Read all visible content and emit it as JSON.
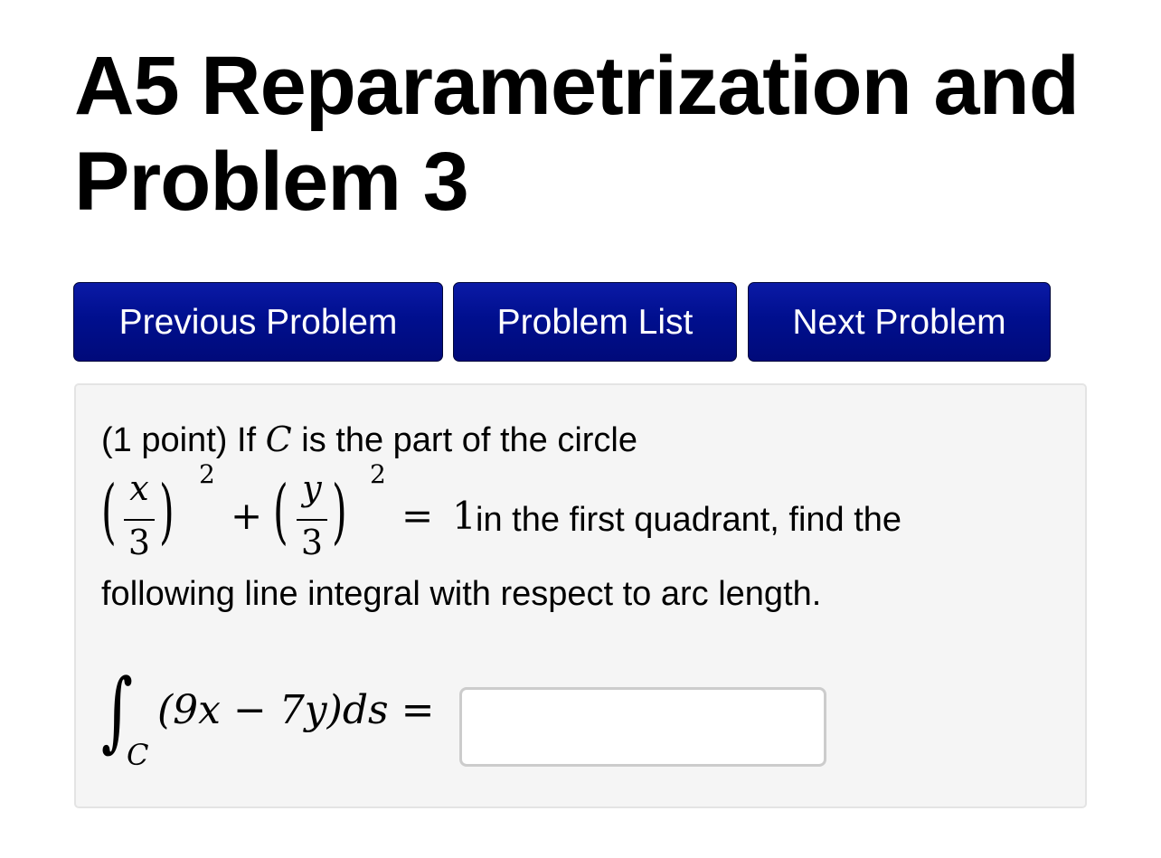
{
  "header": {
    "title_line1": "A5 Reparametrization  and",
    "title_line2": "Problem 3"
  },
  "nav": {
    "previous_label": "Previous Problem",
    "list_label": "Problem List",
    "next_label": "Next Problem"
  },
  "problem": {
    "intro_prefix": "(1 point) If ",
    "curve_symbol": "C",
    "intro_suffix": " is the part of the circle",
    "frac1_num": "x",
    "frac2_num": "y",
    "frac_den": "3",
    "exponent": "2",
    "plus": "+",
    "equals": "=",
    "rhs": "1",
    "line2_text": " in the first quadrant, find the",
    "line3_text": "following line integral with respect to arc length.",
    "integral_symbol": "∫",
    "integral_subscript": "C",
    "integrand": "(9x − 7y)ds =",
    "answer_value": ""
  }
}
